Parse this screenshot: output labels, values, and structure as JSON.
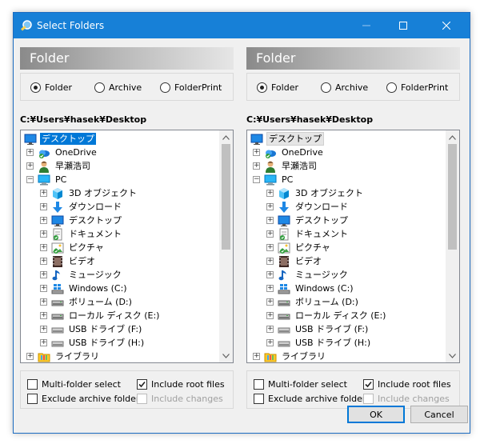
{
  "window": {
    "title": "Select Folders"
  },
  "panes": [
    {
      "header": "Folder",
      "radios": [
        {
          "label": "Folder",
          "checked": true
        },
        {
          "label": "Archive",
          "checked": false
        },
        {
          "label": "FolderPrint",
          "checked": false
        }
      ],
      "path": "C:¥Users¥hasek¥Desktop",
      "tree": [
        {
          "label": "デスクトップ",
          "icon": "desktop-icon",
          "selected": "primary"
        },
        {
          "label": "OneDrive",
          "icon": "onedrive-icon"
        },
        {
          "label": "早瀬浩司",
          "icon": "user-icon"
        },
        {
          "label": "PC",
          "icon": "pc-icon"
        },
        {
          "label": "3D オブジェクト",
          "icon": "3d-objects-icon"
        },
        {
          "label": "ダウンロード",
          "icon": "download-icon"
        },
        {
          "label": "デスクトップ",
          "icon": "desktop-icon"
        },
        {
          "label": "ドキュメント",
          "icon": "documents-icon"
        },
        {
          "label": "ピクチャ",
          "icon": "pictures-icon"
        },
        {
          "label": "ビデオ",
          "icon": "videos-icon"
        },
        {
          "label": "ミュージック",
          "icon": "music-icon"
        },
        {
          "label": "Windows (C:)",
          "icon": "windows-drive-icon"
        },
        {
          "label": "ボリューム (D:)",
          "icon": "drive-icon"
        },
        {
          "label": "ローカル ディスク (E:)",
          "icon": "drive-icon"
        },
        {
          "label": "USB ドライブ (F:)",
          "icon": "usb-drive-icon"
        },
        {
          "label": "USB ドライブ (H:)",
          "icon": "usb-drive-icon"
        },
        {
          "label": "ライブラリ",
          "icon": "library-icon"
        }
      ],
      "options": {
        "multi_folder": {
          "label": "Multi-folder select",
          "checked": false
        },
        "exclude_archive": {
          "label": "Exclude archive folders",
          "checked": false
        },
        "include_root": {
          "label": "Include root files",
          "checked": true
        },
        "include_changes": {
          "label": "Include changes",
          "checked": false
        }
      }
    },
    {
      "header": "Folder",
      "radios": [
        {
          "label": "Folder",
          "checked": true
        },
        {
          "label": "Archive",
          "checked": false
        },
        {
          "label": "FolderPrint",
          "checked": false
        }
      ],
      "path": "C:¥Users¥hasek¥Desktop",
      "tree": [
        {
          "label": "デスクトップ",
          "icon": "desktop-icon",
          "selected": "secondary"
        },
        {
          "label": "OneDrive",
          "icon": "onedrive-icon"
        },
        {
          "label": "早瀬浩司",
          "icon": "user-icon"
        },
        {
          "label": "PC",
          "icon": "pc-icon"
        },
        {
          "label": "3D オブジェクト",
          "icon": "3d-objects-icon"
        },
        {
          "label": "ダウンロード",
          "icon": "download-icon"
        },
        {
          "label": "デスクトップ",
          "icon": "desktop-icon"
        },
        {
          "label": "ドキュメント",
          "icon": "documents-icon"
        },
        {
          "label": "ピクチャ",
          "icon": "pictures-icon"
        },
        {
          "label": "ビデオ",
          "icon": "videos-icon"
        },
        {
          "label": "ミュージック",
          "icon": "music-icon"
        },
        {
          "label": "Windows (C:)",
          "icon": "windows-drive-icon"
        },
        {
          "label": "ボリューム (D:)",
          "icon": "drive-icon"
        },
        {
          "label": "ローカル ディスク (E:)",
          "icon": "drive-icon"
        },
        {
          "label": "USB ドライブ (F:)",
          "icon": "usb-drive-icon"
        },
        {
          "label": "USB ドライブ (H:)",
          "icon": "usb-drive-icon"
        },
        {
          "label": "ライブラリ",
          "icon": "library-icon"
        }
      ],
      "options": {
        "multi_folder": {
          "label": "Multi-folder select",
          "checked": false
        },
        "exclude_archive": {
          "label": "Exclude archive folders",
          "checked": false
        },
        "include_root": {
          "label": "Include root files",
          "checked": true
        },
        "include_changes": {
          "label": "Include changes",
          "checked": false
        }
      }
    }
  ],
  "buttons": {
    "ok": "OK",
    "cancel": "Cancel"
  },
  "colors": {
    "titlebar": "#1780d7",
    "selection": "#0078d7"
  }
}
